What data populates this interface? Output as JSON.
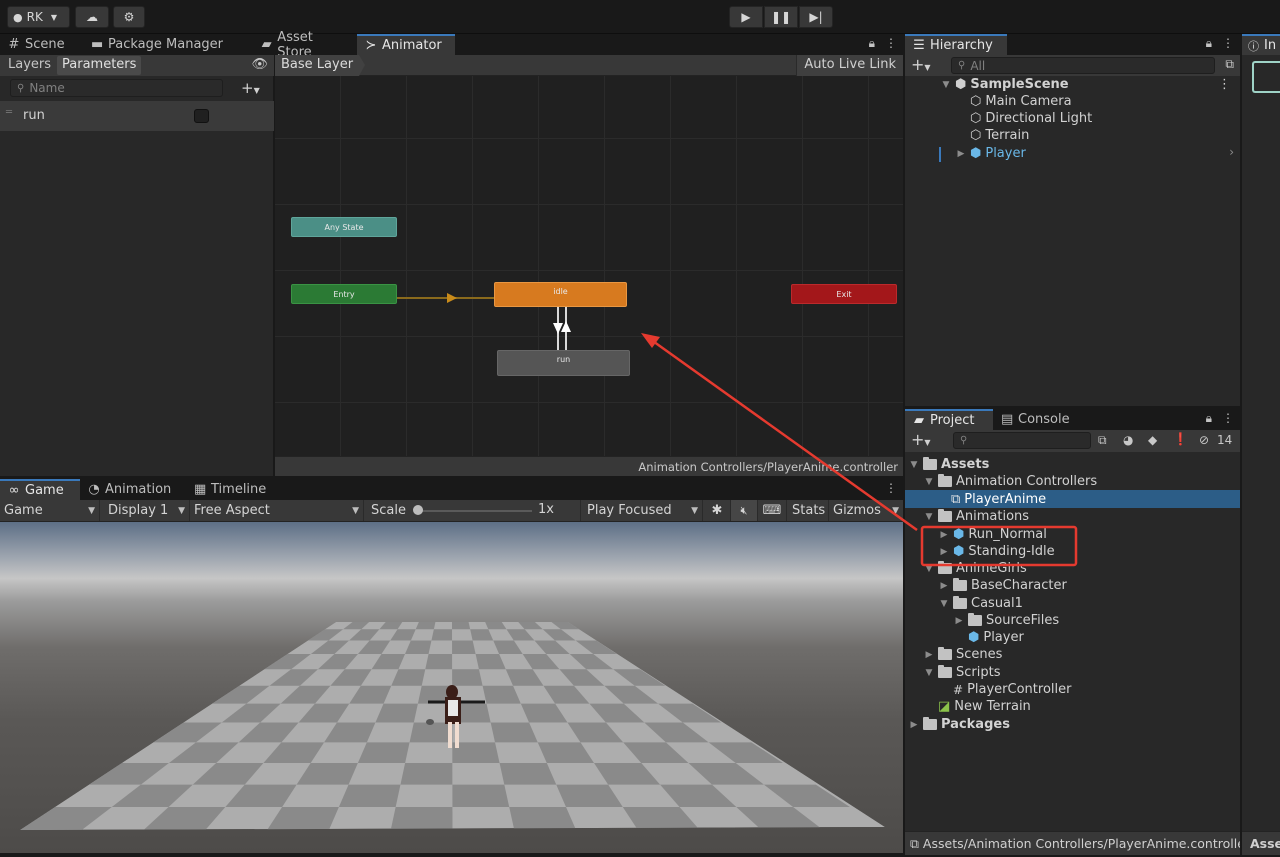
{
  "toolbar": {
    "account_label": "RK",
    "play_icon": "play-icon",
    "pause_icon": "pause-icon",
    "step_icon": "step-icon"
  },
  "top_tabs": [
    {
      "label": "Scene",
      "icon": "hash-icon"
    },
    {
      "label": "Package Manager",
      "icon": "package-icon"
    },
    {
      "label": "Asset Store",
      "icon": "store-icon"
    },
    {
      "label": "Animator",
      "icon": "animator-icon"
    }
  ],
  "animator": {
    "left_tabs": [
      "Layers",
      "Parameters"
    ],
    "search_placeholder": "Name",
    "parameters": [
      {
        "name": "run",
        "type": "bool",
        "value": false
      }
    ],
    "breadcrumb": "Base Layer",
    "auto_live_link": "Auto Live Link",
    "footer_path": "Animation Controllers/PlayerAnime.controller",
    "states": {
      "any_state": "Any State",
      "entry": "Entry",
      "idle": "idle",
      "run": "run",
      "exit": "Exit"
    },
    "colors": {
      "any_state": "#4b8f86",
      "entry": "#2b7a34",
      "idle": "#d77a1f",
      "run": "#555555",
      "exit": "#a3171a"
    }
  },
  "hierarchy": {
    "tab": "Hierarchy",
    "search_placeholder": "All",
    "scene": "SampleScene",
    "items": [
      "Main Camera",
      "Directional Light",
      "Terrain",
      "Player"
    ]
  },
  "inspector_tab": "In",
  "project": {
    "tabs": [
      "Project",
      "Console"
    ],
    "badge_count": "14",
    "tree": [
      {
        "label": "Assets",
        "depth": 0,
        "kind": "folder",
        "bold": true,
        "expanded": true
      },
      {
        "label": "Animation Controllers",
        "depth": 1,
        "kind": "folder",
        "expanded": true
      },
      {
        "label": "PlayerAnime",
        "depth": 2,
        "kind": "controller",
        "selected": true
      },
      {
        "label": "Animations",
        "depth": 1,
        "kind": "folder",
        "expanded": true
      },
      {
        "label": "Run_Normal",
        "depth": 2,
        "kind": "model",
        "collapsed": true
      },
      {
        "label": "Standing-Idle",
        "depth": 2,
        "kind": "model",
        "collapsed": true
      },
      {
        "label": "AnimeGirls",
        "depth": 1,
        "kind": "folder",
        "expanded": true
      },
      {
        "label": "BaseCharacter",
        "depth": 2,
        "kind": "folder",
        "collapsed": true
      },
      {
        "label": "Casual1",
        "depth": 2,
        "kind": "folder",
        "expanded": true
      },
      {
        "label": "SourceFiles",
        "depth": 3,
        "kind": "folder",
        "collapsed": true
      },
      {
        "label": "Player",
        "depth": 3,
        "kind": "prefab"
      },
      {
        "label": "Scenes",
        "depth": 1,
        "kind": "folder",
        "collapsed": true
      },
      {
        "label": "Scripts",
        "depth": 1,
        "kind": "folder",
        "expanded": true
      },
      {
        "label": "PlayerController",
        "depth": 2,
        "kind": "script"
      },
      {
        "label": "New Terrain",
        "depth": 1,
        "kind": "terrain"
      },
      {
        "label": "Packages",
        "depth": 0,
        "kind": "folder",
        "bold": true,
        "collapsed": true
      }
    ],
    "footer_path": "Assets/Animation Controllers/PlayerAnime.controlle",
    "right_footer": "Asse"
  },
  "bottom_tabs": [
    {
      "label": "Game",
      "icon": "gamepad-icon"
    },
    {
      "label": "Animation",
      "icon": "clock-icon"
    },
    {
      "label": "Timeline",
      "icon": "film-icon"
    }
  ],
  "game_toolbar": {
    "mode": "Game",
    "display": "Display 1",
    "aspect": "Free Aspect",
    "scale_label": "Scale",
    "scale_value": "1x",
    "scale_fraction": 0.0,
    "play_focused": "Play Focused",
    "stats": "Stats",
    "gizmos": "Gizmos"
  },
  "annotation_color": "#e53a2f"
}
